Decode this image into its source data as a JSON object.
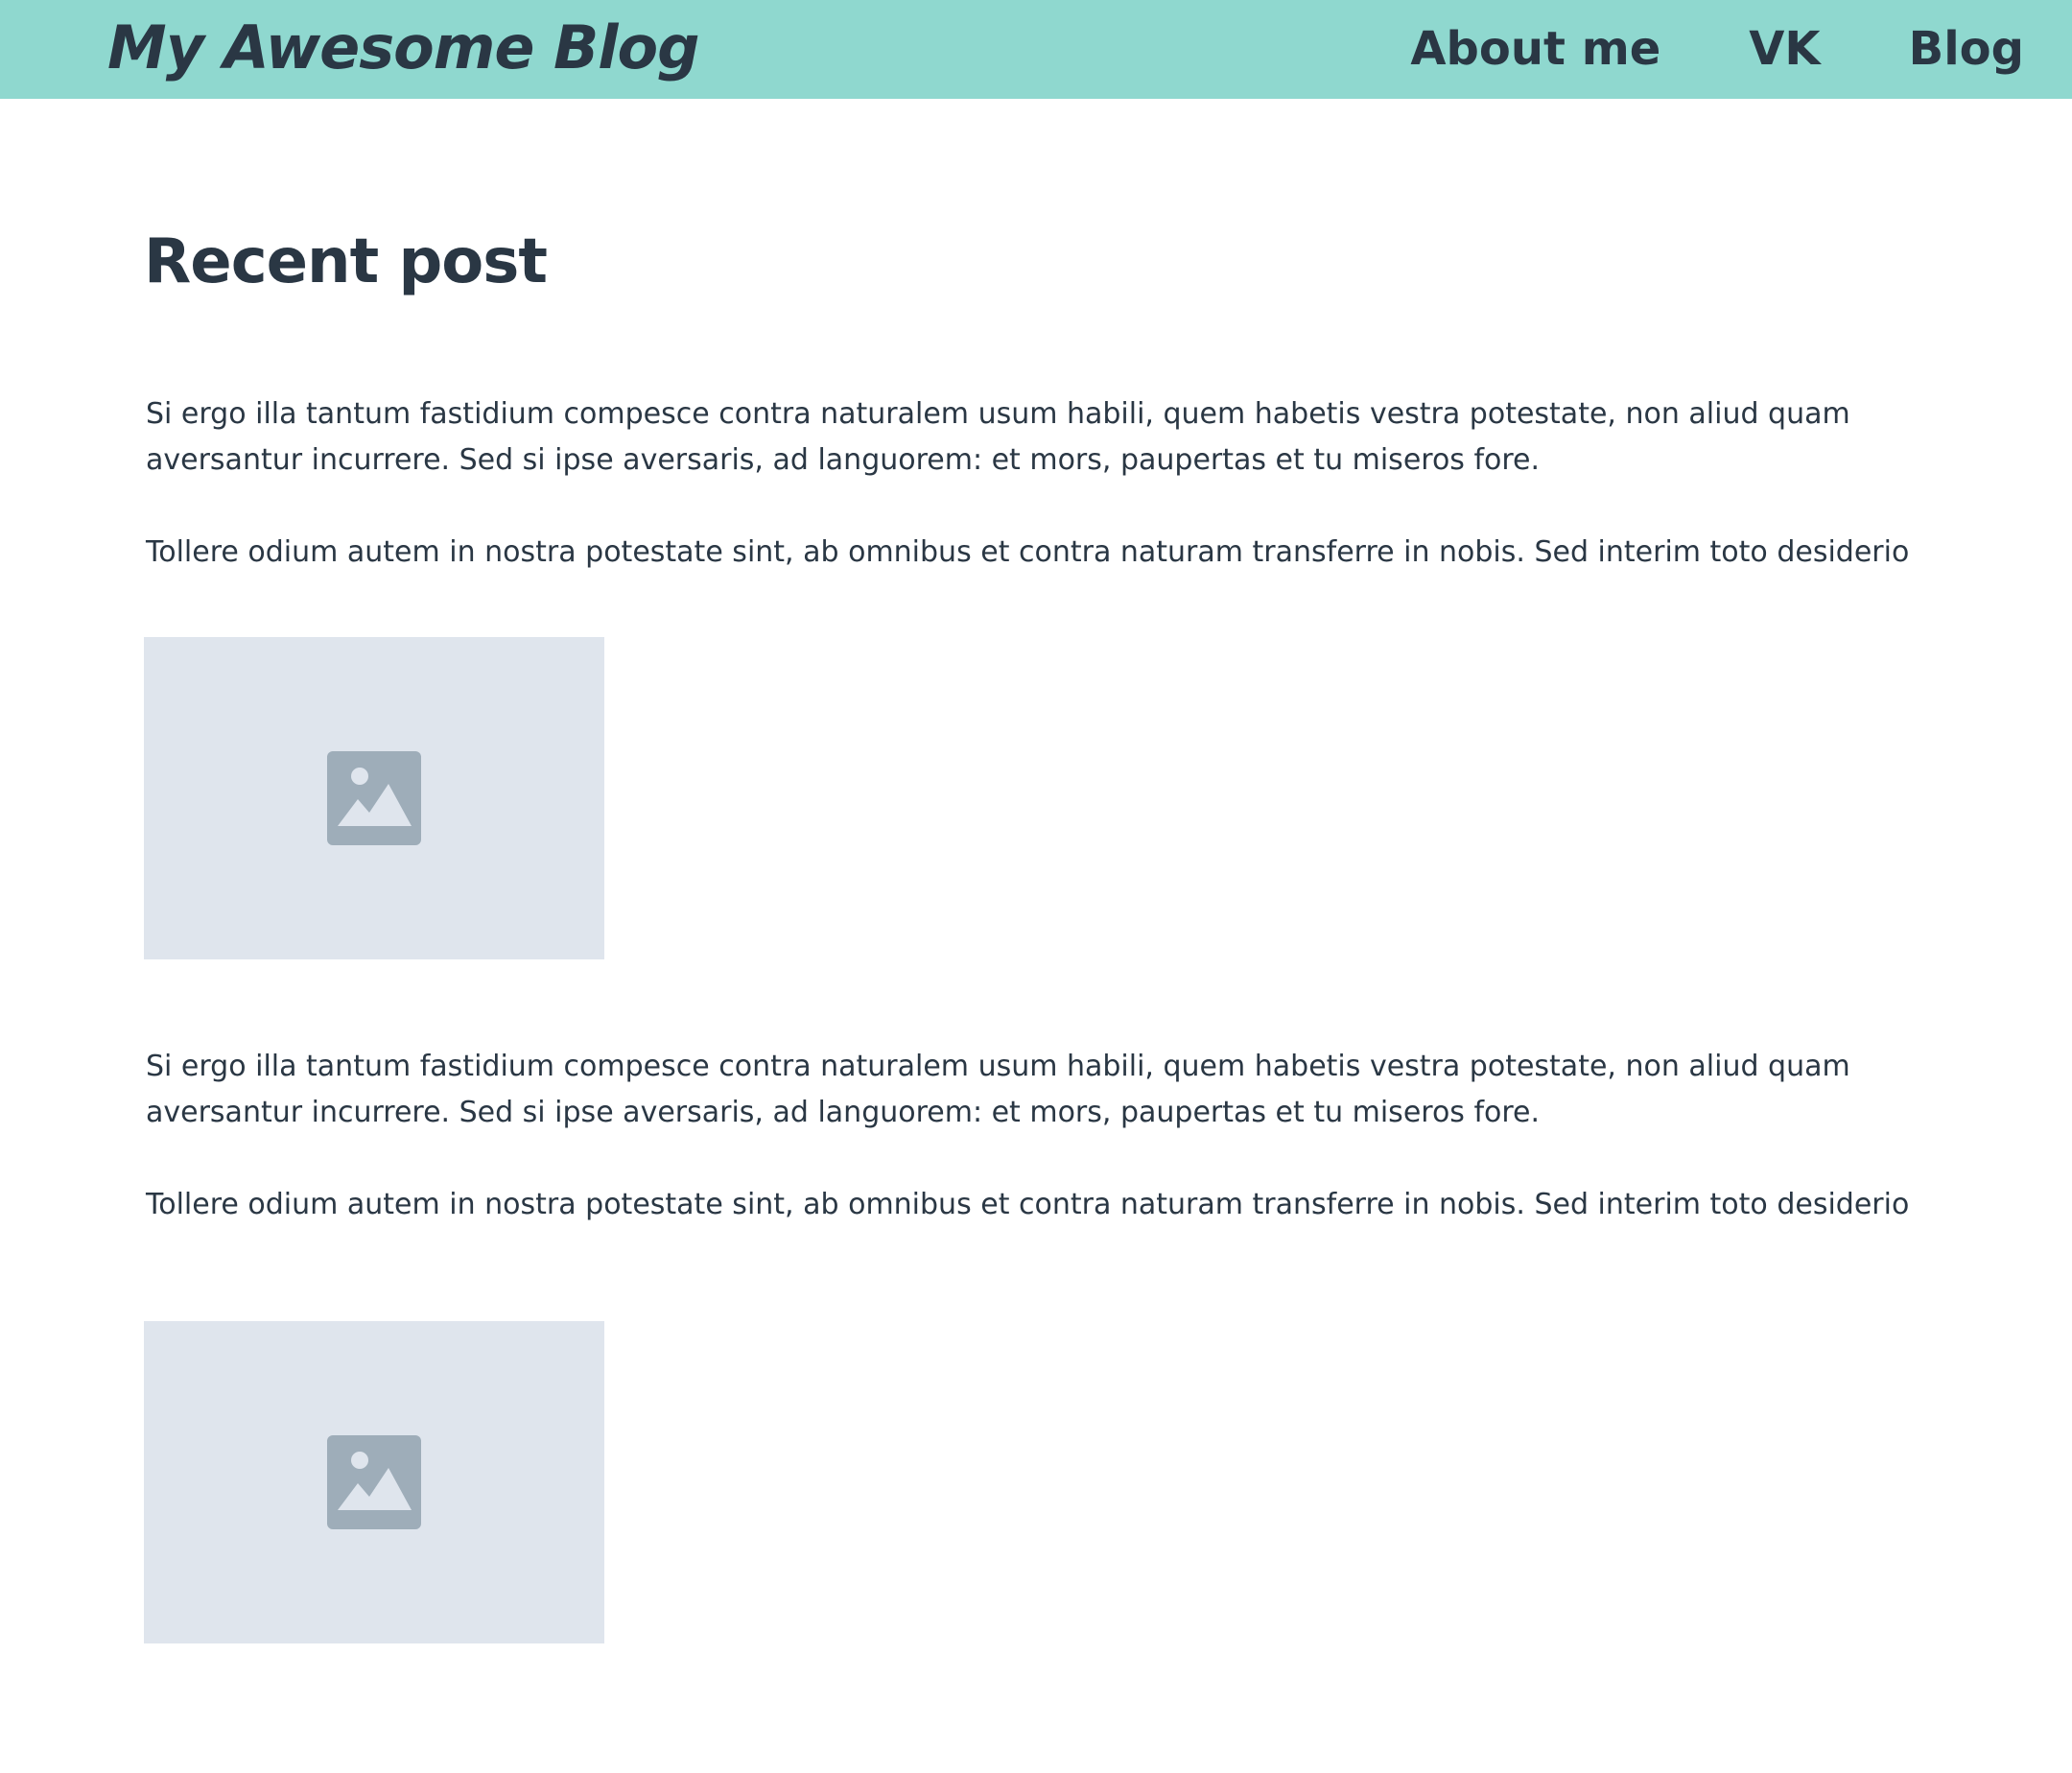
{
  "header": {
    "logo": "My Awesome Blog",
    "nav": [
      {
        "label": "About me"
      },
      {
        "label": "VK"
      },
      {
        "label": "Blog"
      }
    ]
  },
  "main": {
    "title": "Recent post",
    "sections": [
      {
        "paragraph1_lines": [
          "Si ergo illa tantum fastidium compesce contra naturalem usum habili, quem habetis vestra potestate, non aliud quam",
          "aversantur incurrere. Sed si ipse aversaris, ad languorem: et mors, paupertas et tu miseros fore."
        ],
        "paragraph2": "Tollere odium autem in nostra potestate sint, ab omnibus et contra naturam transferre in nobis. Sed interim toto desiderio",
        "image_icon": "image-placeholder-icon"
      },
      {
        "paragraph1_lines": [
          "Si ergo illa tantum fastidium compesce contra naturalem usum habili, quem habetis vestra potestate, non aliud quam",
          "aversantur incurrere. Sed si ipse aversaris, ad languorem: et mors, paupertas et tu miseros fore."
        ],
        "paragraph2": "Tollere odium autem in nostra potestate sint, ab omnibus et contra naturam transferre in nobis. Sed interim toto desiderio",
        "image_icon": "image-placeholder-icon"
      }
    ]
  },
  "colors": {
    "header_bg": "#8fd8cf",
    "text": "#2a3744",
    "image_bg": "#dfe5ed",
    "image_icon": "#9eadb9"
  }
}
